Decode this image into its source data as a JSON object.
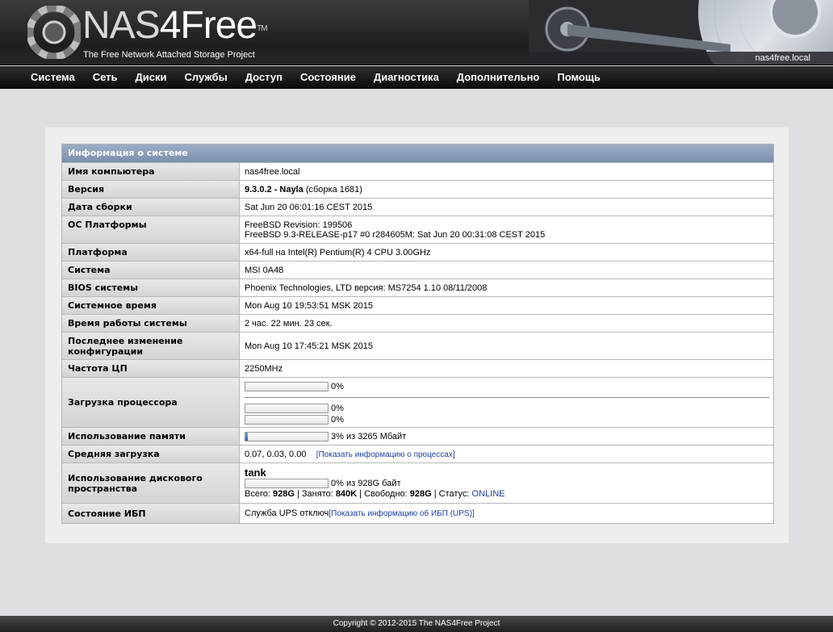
{
  "header": {
    "logo_name": "NAS",
    "logo_four": "4Free",
    "logo_tm": "TM",
    "tagline": "The Free Network Attached Storage Project",
    "hostname": "nas4free.local"
  },
  "nav": {
    "items": [
      "Система",
      "Сеть",
      "Диски",
      "Службы",
      "Доступ",
      "Состояние",
      "Диагностика",
      "Дополнительно",
      "Помощь"
    ]
  },
  "info": {
    "title": "Информация о системе",
    "hostname": {
      "label": "Имя компьютера",
      "value": "nas4free.local"
    },
    "version": {
      "label": "Версия",
      "number": "9.3.0.2",
      "dash": " - ",
      "codename": "Nayla",
      "build": " (сборка 1681)"
    },
    "build_date": {
      "label": "Дата сборки",
      "value": "Sat Jun 20 06:01:16 CEST 2015"
    },
    "os": {
      "label": "ОС Платформы",
      "line1": "FreeBSD Revision: 199506",
      "line2": "FreeBSD 9.3-RELEASE-p17 #0 r284605M: Sat Jun 20 00:31:08 CEST 2015"
    },
    "platform": {
      "label": "Платформа",
      "value": "x64-full на Intel(R) Pentium(R) 4 CPU 3.00GHz"
    },
    "system": {
      "label": "Система",
      "value": "MSI 0A48"
    },
    "bios": {
      "label": "BIOS системы",
      "value": "Phoenix Technologies, LTD версия: MS7254 1.10 08/11/2008"
    },
    "time": {
      "label": "Системное время",
      "value": "Mon Aug 10 19:53:51 MSK 2015"
    },
    "uptime": {
      "label": "Время работы системы",
      "value": "2 час. 22 мин. 23 сек."
    },
    "last_change": {
      "label": "Последнее изменение конфигурации",
      "value": "Mon Aug 10 17:45:21 MSK 2015"
    },
    "cpu_freq": {
      "label": "Частота ЦП",
      "value": "2250MHz"
    },
    "cpu_load": {
      "label": "Загрузка процессора",
      "total_text": "0%",
      "total": 0,
      "core1_text": "0%",
      "core1": 0,
      "core2_text": "0%",
      "core2": 0
    },
    "memory": {
      "label": "Использование памяти",
      "text": "3% из 3265 Мбайт",
      "percent": 3
    },
    "load_avg": {
      "label": "Средняя загрузка",
      "value": "0.07, 0.03, 0.00",
      "link": "Показать информацию о процессах"
    },
    "disk": {
      "label": "Использование дискового пространства",
      "pool": "tank",
      "usage_text": "0% из 928G байт",
      "percent": 0,
      "total_label": "Всего: ",
      "total": "928G",
      "used_label": " | Занято: ",
      "used": "840K",
      "free_label": " | Свободно: ",
      "free": "928G",
      "status_label": " | Статус: ",
      "status": "ONLINE"
    },
    "ups": {
      "label": "Состояние ИБП",
      "value": "Служба UPS отключ",
      "link": "Показать информацию об ИБП (UPS)"
    }
  },
  "footer": {
    "text": "Copyright © 2012-2015 The NAS4Free Project"
  }
}
